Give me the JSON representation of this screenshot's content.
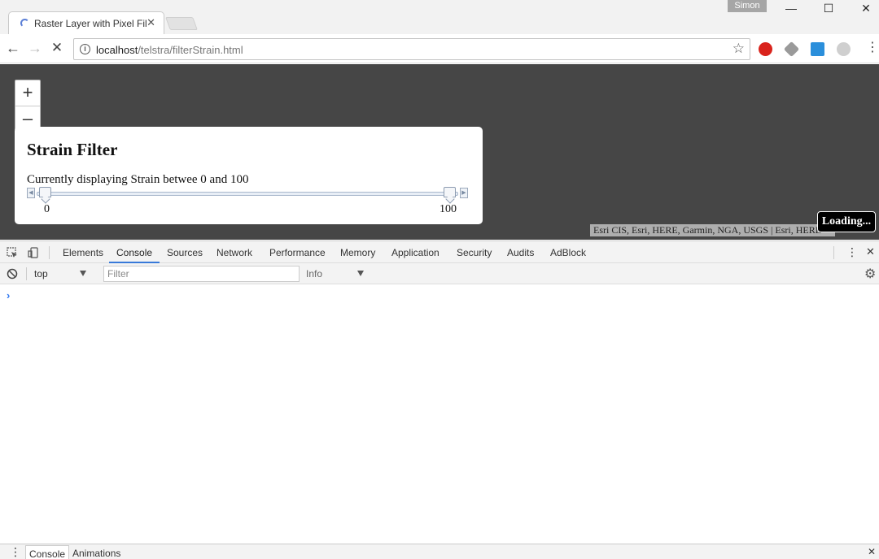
{
  "browser": {
    "tab_title": "Raster Layer with Pixel Filter",
    "profile_name": "Simon",
    "url_host": "localhost",
    "url_path": "/telstra/filterStrain.html",
    "window_controls": {
      "minimize": "—",
      "maximize": "☐",
      "close": "✕"
    }
  },
  "page": {
    "zoom_in": "+",
    "zoom_out": "–",
    "panel": {
      "title": "Strain Filter",
      "description": "Currently displaying Strain betwee 0 and 100",
      "slider_min_label": "0",
      "slider_max_label": "100",
      "slider_min_value": 0,
      "slider_max_value": 100
    },
    "attribution": "Esri CIS, Esri, HERE, Garmin, NGA, USGS | Esri, HERE",
    "loading_label": "Loading..."
  },
  "devtools": {
    "tabs": [
      "Elements",
      "Console",
      "Sources",
      "Network",
      "Performance",
      "Memory",
      "Application",
      "Security",
      "Audits",
      "AdBlock"
    ],
    "active_tab": "Console",
    "context": "top",
    "filter_placeholder": "Filter",
    "log_level": "Info",
    "prompt": "›",
    "drawer_tabs": [
      "Console",
      "Animations"
    ]
  },
  "colors": {
    "map_background": "#464646",
    "devtools_accent": "#3879d9"
  }
}
